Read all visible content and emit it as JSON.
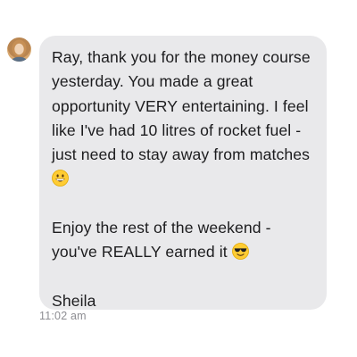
{
  "message": {
    "lines": [
      "Ray, thank you for the money course",
      "yesterday.  You made a great",
      "opportunity VERY entertaining.  I feel",
      "like I've had 10 litres of rocket fuel  -",
      "just need to stay away from matches"
    ],
    "emoji_1": "grinning-face-emoji",
    "line_6": "Enjoy the rest of the weekend -",
    "line_7": "you've REALLY earned it",
    "emoji_2": "smiling-face-with-sunglasses-emoji",
    "signature": "Sheila",
    "timestamp": "11:02 am"
  },
  "colors": {
    "bubble": "#e9e9eb",
    "text": "#1c1c1e",
    "timestamp": "#8e8e93",
    "emoji_yellow": "#ffcc33"
  }
}
